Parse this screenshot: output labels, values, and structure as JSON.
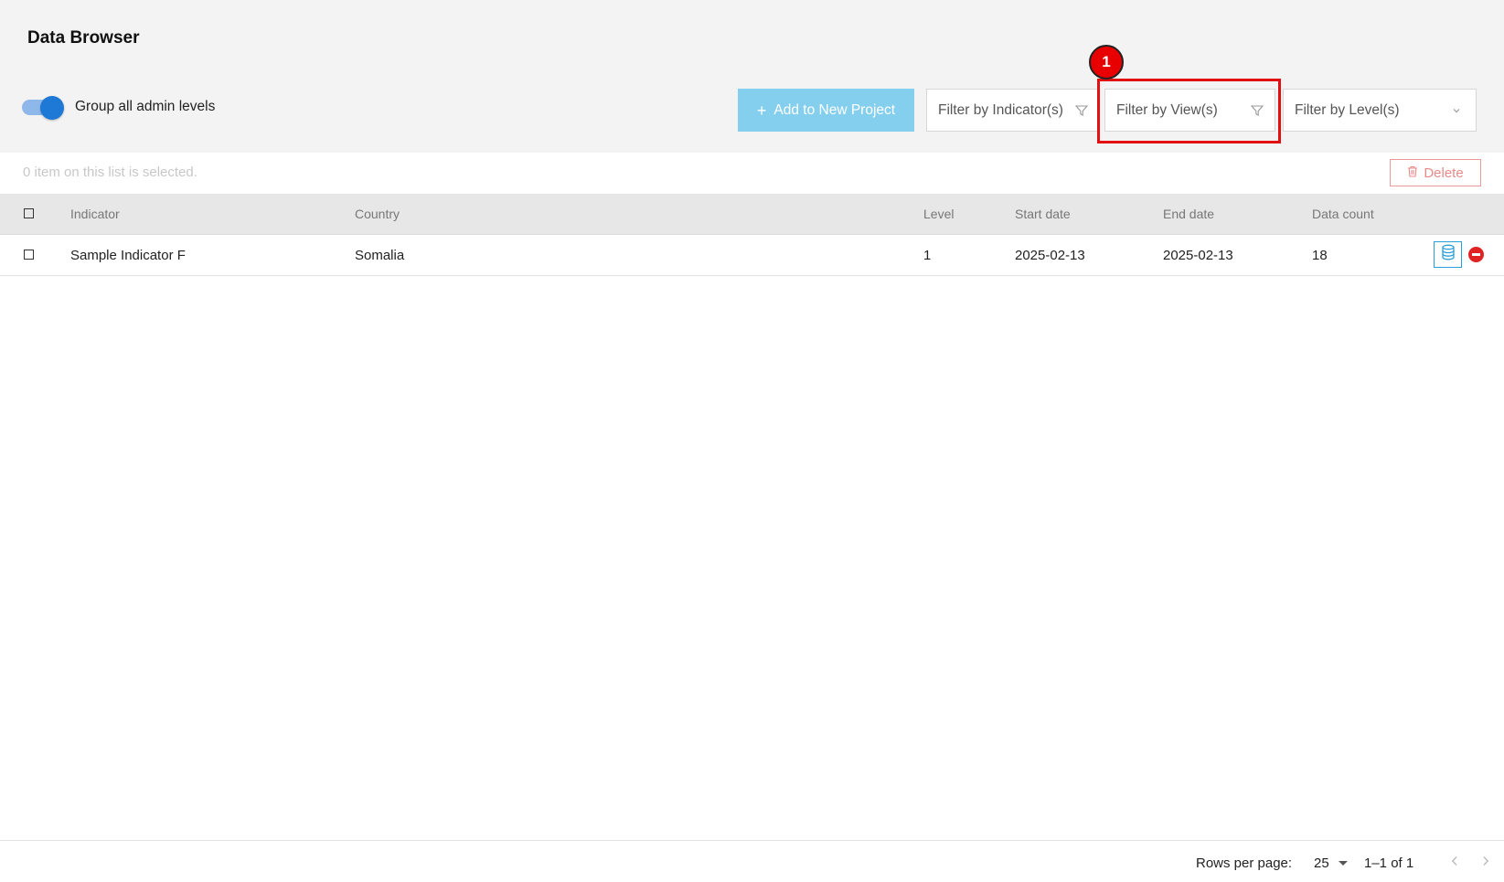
{
  "page": {
    "title": "Data Browser"
  },
  "toggle": {
    "label": "Group all admin levels",
    "on": true
  },
  "toolbar": {
    "add_button_label": "Add to New Project",
    "add_button_icon": "plus-icon",
    "filter_indicator_placeholder": "Filter by Indicator(s)",
    "filter_view_placeholder": "Filter by View(s)",
    "filter_level_placeholder": "Filter by Level(s)",
    "filter_icon": "funnel-icon",
    "dropdown_icon": "chevron-down-icon"
  },
  "annotation": {
    "marker_number": "1",
    "color": "#e21010"
  },
  "selection": {
    "status_text": "0 item on this list is selected.",
    "delete_label": "Delete",
    "delete_icon": "trash-icon"
  },
  "table": {
    "columns": [
      "Indicator",
      "Country",
      "Level",
      "Start date",
      "End date",
      "Data count"
    ],
    "rows": [
      {
        "indicator": "Sample Indicator F",
        "country": "Somalia",
        "level": "1",
        "start_date": "2025-02-13",
        "end_date": "2025-02-13",
        "data_count": "18",
        "actions": [
          "database-icon",
          "remove-icon"
        ]
      }
    ]
  },
  "pagination": {
    "rows_per_page_label": "Rows per page:",
    "rows_per_page_value": "25",
    "range_text": "1–1 of 1"
  },
  "colors": {
    "accent": "#1e78d6",
    "add_button": "#85cfee",
    "delete": "#e88a8a",
    "remove": "#e02424",
    "header_bg": "#f3f3f3",
    "table_header_bg": "#e7e7e7"
  }
}
